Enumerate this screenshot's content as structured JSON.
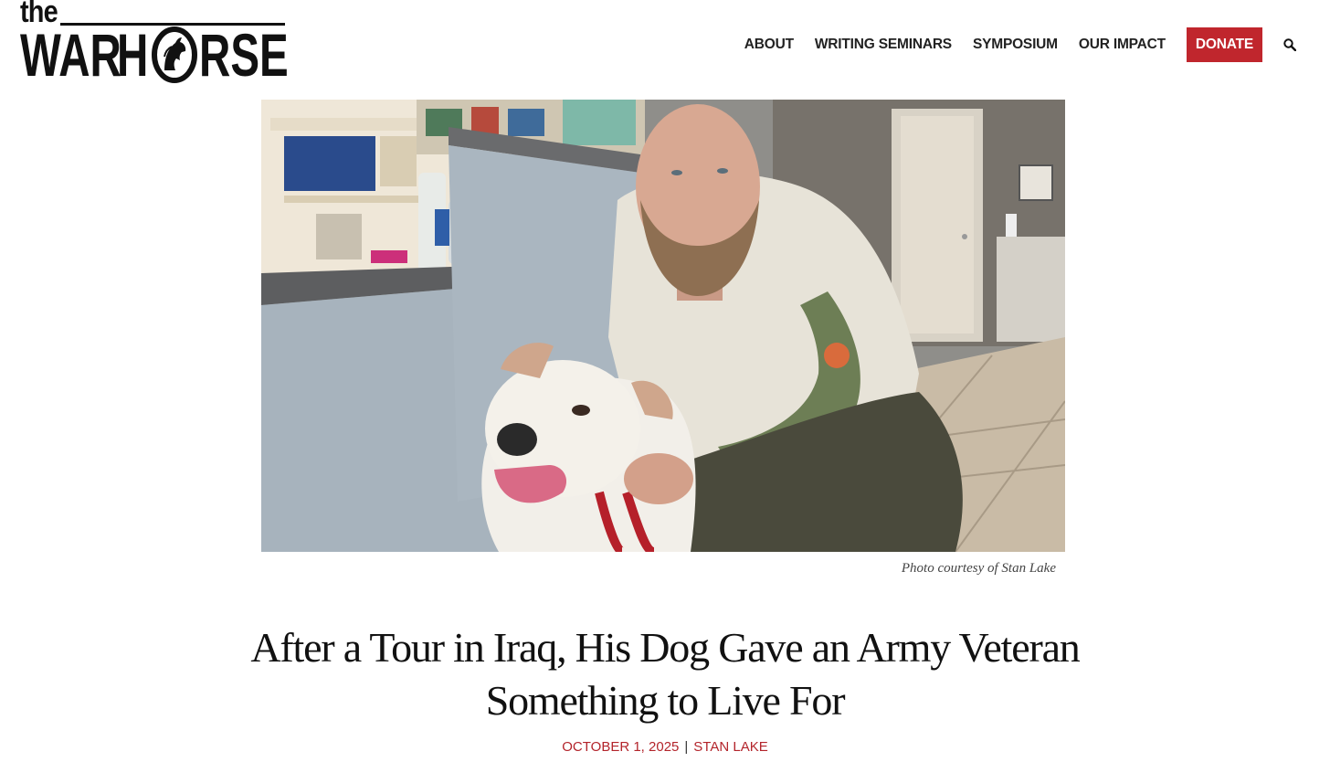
{
  "brand": {
    "logo_text": "the WAR HORSE",
    "logo_the": "the",
    "logo_war": "WAR",
    "logo_h": "H",
    "logo_rse": "RSE"
  },
  "nav": {
    "items": [
      {
        "label": "ABOUT"
      },
      {
        "label": "WRITING SEMINARS"
      },
      {
        "label": "SYMPOSIUM"
      },
      {
        "label": "OUR IMPACT"
      }
    ],
    "donate_label": "DONATE",
    "search_icon": "search-icon"
  },
  "article": {
    "photo_caption": "Photo courtesy of Stan Lake",
    "headline": "After a Tour in Iraq, His Dog Gave an Army Veteran Something to Live For",
    "date": "OCTOBER 1, 2025",
    "author": "STAN LAKE"
  },
  "colors": {
    "accent": "#c0262d",
    "byline": "#b3242b",
    "text": "#111111"
  }
}
